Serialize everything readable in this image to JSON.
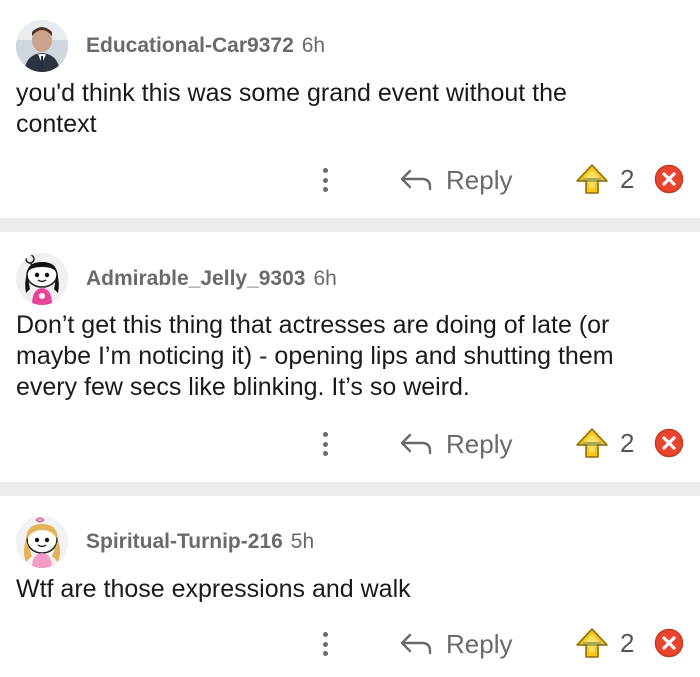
{
  "comments": [
    {
      "username": "Educational-Car9372",
      "age": "6h",
      "avatar": "office-worker-avatar",
      "text": "you'd think this was some grand event without the context",
      "reply_label": "Reply",
      "score": "2"
    },
    {
      "username": "Admirable_Jelly_9303",
      "age": "6h",
      "avatar": "snoo-avatar-dark-hair",
      "text": "Don’t get this thing that actresses are doing of late (or maybe I’m noticing it) - opening lips and shutting them every few secs like blinking. It’s so weird.",
      "reply_label": "Reply",
      "score": "2"
    },
    {
      "username": "Spiritual-Turnip-216",
      "age": "5h",
      "avatar": "snoo-avatar-blonde-hair",
      "text": "Wtf are those expressions and walk",
      "reply_label": "Reply",
      "score": "2"
    }
  ],
  "icons": {
    "more": "more-vertical-icon",
    "reply": "reply-arrow-icon",
    "upvote": "upvote-icon",
    "downvote": "downvote-icon"
  },
  "colors": {
    "meta_gray": "#6a6a6a",
    "upvote_gold": "#f5c518",
    "downvote_red": "#e8452c",
    "divider": "#ececec"
  }
}
